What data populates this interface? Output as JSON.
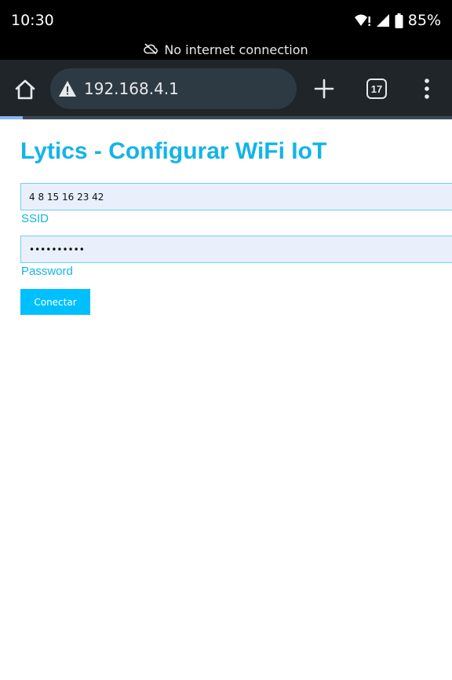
{
  "status_bar": {
    "time": "10:30",
    "battery": "85%",
    "icons": [
      "wifi-alert-icon",
      "cell-signal-icon",
      "battery-icon"
    ]
  },
  "network_banner": {
    "text": "No internet connection",
    "icon": "cloud-off-icon"
  },
  "browser": {
    "url": "192.168.4.1",
    "security_icon": "warning-icon",
    "tab_count": "17",
    "load_progress": 0.05,
    "colors": {
      "toolbar": "#1f2529",
      "omnibox": "#2e3a43",
      "progress": "#8ab4f8"
    }
  },
  "page": {
    "title": "Lytics - Configurar WiFi IoT",
    "ssid": {
      "value": "4 8 15 16 23 42",
      "label": "SSID"
    },
    "password": {
      "value": "••••••••••",
      "label": "Password"
    },
    "connect_label": "Conectar",
    "colors": {
      "accent": "#13b4e8",
      "button": "#00bfff",
      "field_bg": "#e9f0fb"
    }
  }
}
